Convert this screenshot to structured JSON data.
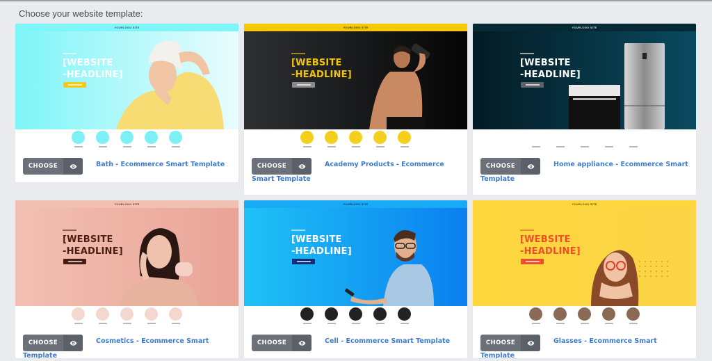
{
  "page": {
    "title": "Choose your website template:"
  },
  "common": {
    "choose_label": "CHOOSE",
    "preview_icon": "eye-icon",
    "hero_headline": "[WEBSITE\n-HEADLINE]",
    "logo_text": "YOURLOGO SITE"
  },
  "templates": [
    {
      "title": "Bath - Ecommerce Smart Template",
      "colors": {
        "bg1": "#7ef5f8",
        "bg2": "#e9fcfd",
        "topbar": "#7ef5f8",
        "headline": "#ffffff",
        "button": "#f7c71a",
        "cat": "#7eeff5",
        "logo": "#2b5a5f"
      },
      "figure": "woman-towel",
      "categories": 5
    },
    {
      "title": "Academy Products - Ecommerce Smart Template",
      "colors": {
        "bg1": "#2e2f31",
        "bg2": "#050505",
        "topbar": "#f6c900",
        "headline": "#f1c40f",
        "button": "#8a8a8a",
        "cat": "#f5cf1e",
        "logo": "#3a3000"
      },
      "figure": "athlete",
      "categories": 5
    },
    {
      "title": "Home appliance - Ecommerce Smart Template",
      "colors": {
        "bg1": "#031b24",
        "bg2": "#0a4a5f",
        "topbar": "#052a36",
        "headline": "#ffffff",
        "button": "#5c6266",
        "cat": "#ffffff",
        "logo": "#cfe0e6"
      },
      "figure": "appliances",
      "categories": 5
    },
    {
      "title": "Cosmetics - Ecommerce Smart Template",
      "colors": {
        "bg1": "#f2c0b2",
        "bg2": "#e9a497",
        "topbar": "#f2c0b2",
        "headline": "#4a1e12",
        "button": "#4a1e12",
        "cat": "#f4d8cf",
        "logo": "#7a3a2a"
      },
      "figure": "woman-cream",
      "categories": 5
    },
    {
      "title": "Cell - Ecommerce Smart Template",
      "colors": {
        "bg1": "#1fc2f6",
        "bg2": "#0a7ff0",
        "topbar": "#18aaf5",
        "headline": "#ffffff",
        "button": "#102f7a",
        "cat": "#222222",
        "logo": "#0d3a6a"
      },
      "figure": "man-phone",
      "categories": 5
    },
    {
      "title": "Glasses - Ecommerce Smart Template",
      "colors": {
        "bg1": "#fcd63c",
        "bg2": "#fbd447",
        "topbar": "#fcd63c",
        "headline": "#f04d2b",
        "button": "#f04d2b",
        "cat": "#8a6a55",
        "logo": "#6a5200"
      },
      "figure": "woman-glasses",
      "categories": 5
    }
  ]
}
